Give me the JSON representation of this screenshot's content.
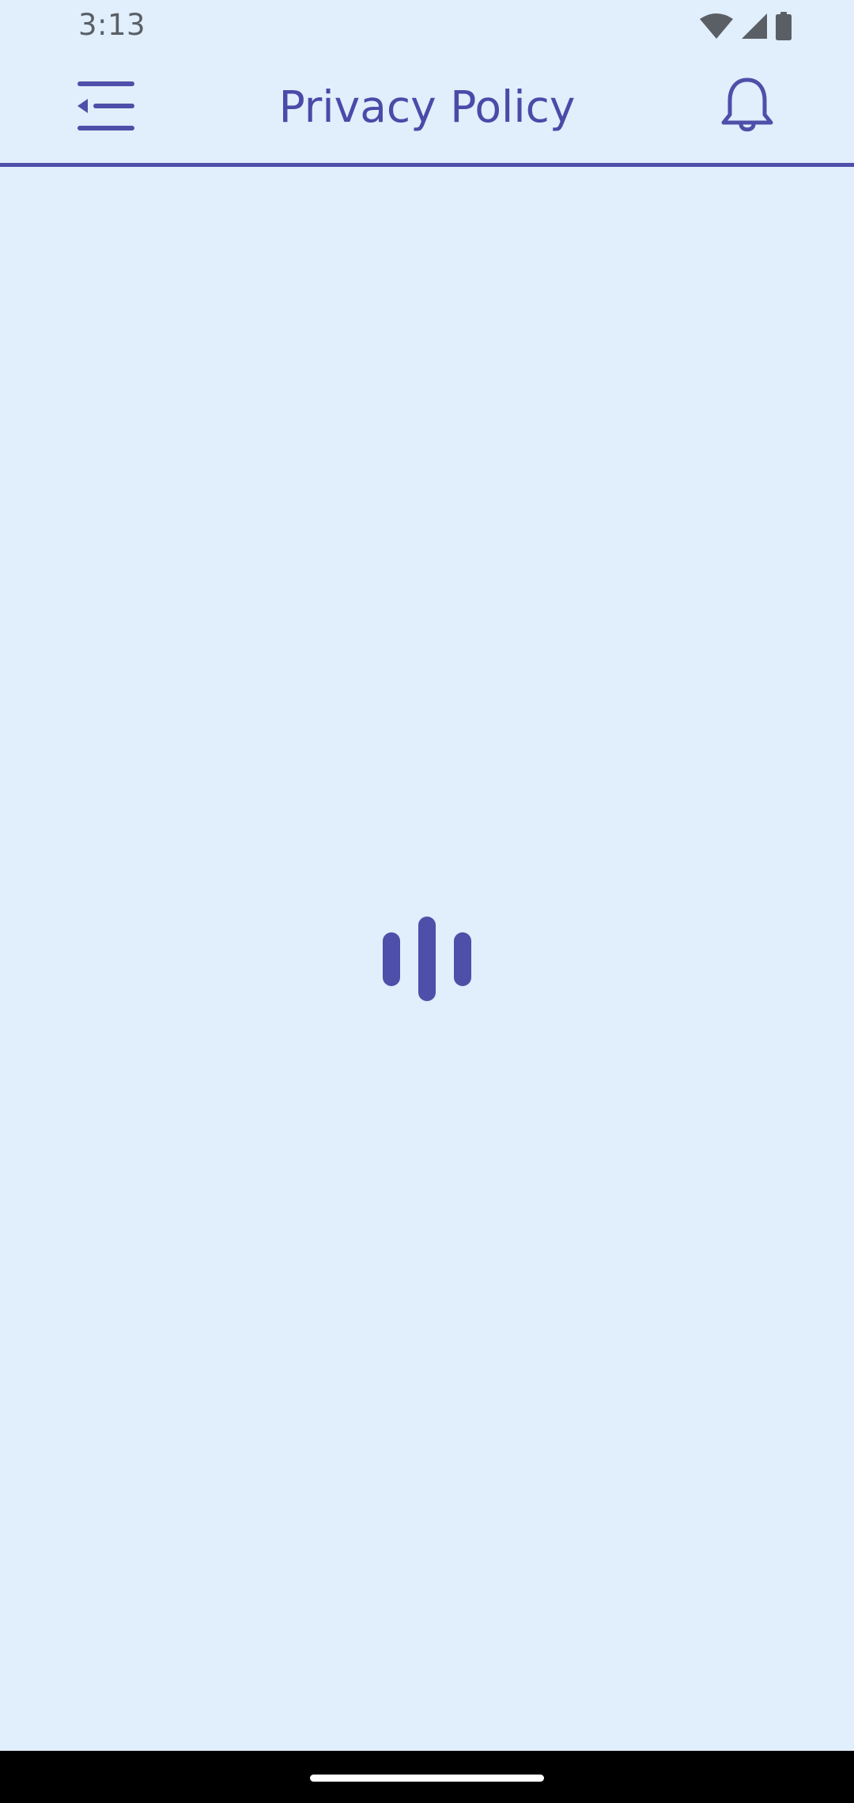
{
  "status_bar": {
    "time": "3:13",
    "icons": [
      "wifi-icon",
      "signal-icon",
      "battery-icon"
    ]
  },
  "app_bar": {
    "menu_icon": "menu-collapse-icon",
    "title": "Privacy Policy",
    "notification_icon": "bell-icon"
  },
  "content": {
    "state": "loading",
    "loader_icon": "loading-bars-icon"
  },
  "navigation": {
    "home_handle": "gesture-handle"
  },
  "colors": {
    "background": "#e1eefb",
    "accent": "#4d4fa9",
    "title": "#4a4aa8",
    "status_text": "#5a5f66",
    "nav_bar": "#000000"
  }
}
